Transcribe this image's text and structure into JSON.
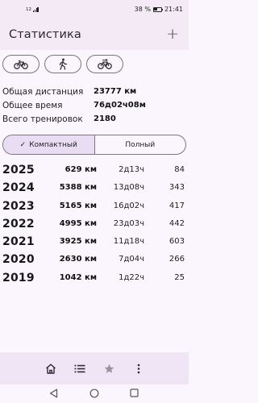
{
  "status_bar": {
    "left_indicator": "12",
    "battery": "38 %",
    "time": "21:41"
  },
  "app_bar": {
    "title": "Статистика",
    "add_icon": "plus-icon"
  },
  "activity_types": [
    {
      "icon": "bicycle-icon"
    },
    {
      "icon": "walking-icon"
    },
    {
      "icon": "bicycle-alt-icon"
    }
  ],
  "summary": {
    "total_distance_label": "Общая дистанция",
    "total_distance_value": "23777 км",
    "total_time_label": "Общее время",
    "total_time_value": "76д02ч08м",
    "total_workouts_label": "Всего тренировок",
    "total_workouts_value": "2180"
  },
  "view_toggle": {
    "compact_label": "Компактный",
    "full_label": "Полный",
    "selected": "compact"
  },
  "years": [
    {
      "year": "2025",
      "distance": "629 км",
      "time": "2д13ч",
      "count": "84"
    },
    {
      "year": "2024",
      "distance": "5388 км",
      "time": "13д08ч",
      "count": "343"
    },
    {
      "year": "2023",
      "distance": "5165 км",
      "time": "16д02ч",
      "count": "417"
    },
    {
      "year": "2022",
      "distance": "4995 км",
      "time": "23д03ч",
      "count": "442"
    },
    {
      "year": "2021",
      "distance": "3925 км",
      "time": "11д18ч",
      "count": "603"
    },
    {
      "year": "2020",
      "distance": "2630 км",
      "time": "7д04ч",
      "count": "266"
    },
    {
      "year": "2019",
      "distance": "1042 км",
      "time": "1д22ч",
      "count": "25"
    }
  ],
  "bottom_nav": [
    {
      "icon": "home-icon"
    },
    {
      "icon": "list-icon"
    },
    {
      "icon": "star-icon"
    },
    {
      "icon": "more-vertical-icon"
    }
  ],
  "system_nav": {
    "back": "back-icon",
    "home": "circle-home-icon",
    "recents": "square-recents-icon"
  }
}
